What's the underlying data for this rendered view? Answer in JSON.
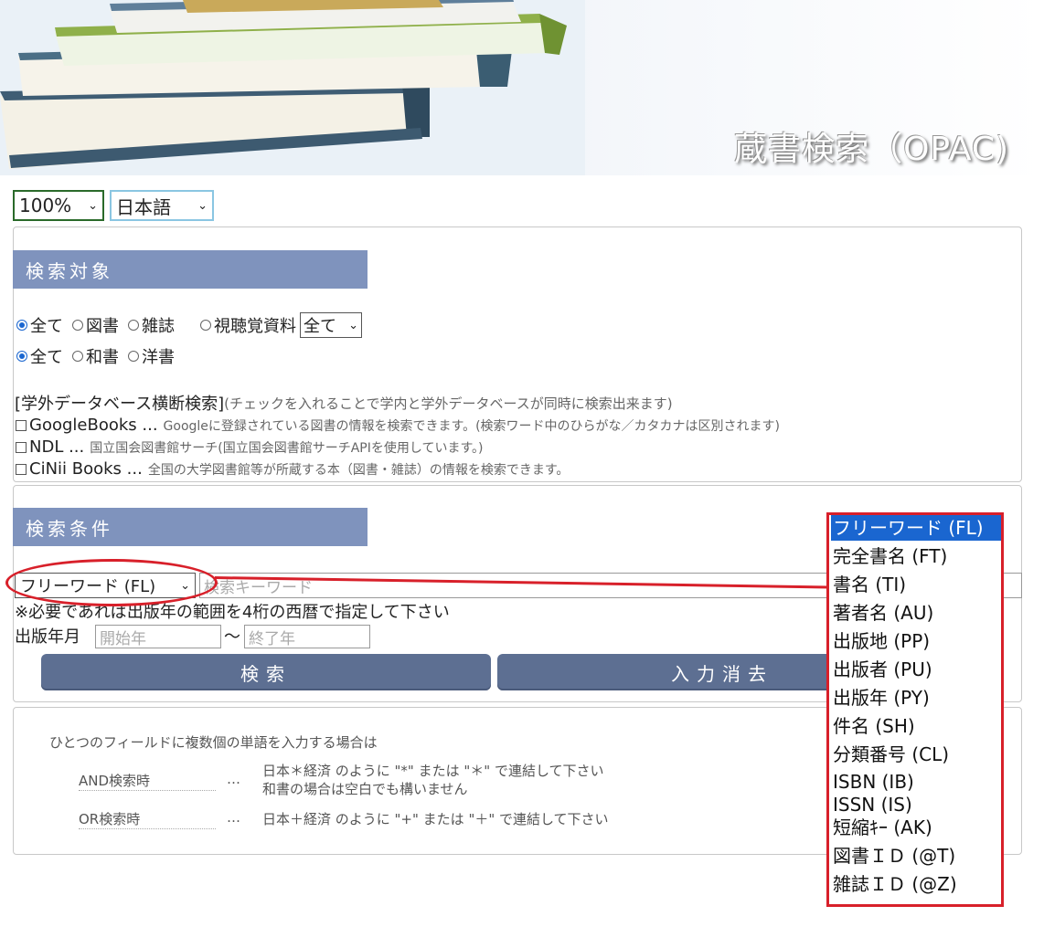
{
  "banner": {
    "title": "蔵書検索（OPAC)"
  },
  "toolbar": {
    "zoom": "100%",
    "language": "日本語"
  },
  "target": {
    "heading": "検索対象",
    "type_options": [
      "全て",
      "図書",
      "雑誌"
    ],
    "av_label": "視聴覚資料",
    "av_select": "全て",
    "lang_options": [
      "全て",
      "和書",
      "洋書"
    ],
    "cross_search_label": "[学外データベース横断検索]",
    "cross_search_note": "(チェックを入れることで学内と学外データベースが同時に検索出来ます)",
    "databases": [
      {
        "name": "GoogleBooks ...",
        "note": "Googleに登録されている図書の情報を検索できます。(検索ワード中のひらがな／カタカナは区別されます)"
      },
      {
        "name": "NDL ...",
        "note": "国立国会図書館サーチ(国立国会図書館サーチAPIを使用しています。)"
      },
      {
        "name": "CiNii Books ...",
        "note": "全国の大学図書館等が所蔵する本（図書・雑誌）の情報を検索できます。"
      }
    ]
  },
  "conditions": {
    "heading": "検索条件",
    "field_select": "フリーワード (FL)",
    "keyword_placeholder": "検索キーワード",
    "year_note": "※必要であれば出版年の範囲を4桁の西暦で指定して下さい",
    "year_label": "出版年月",
    "year_start_placeholder": "開始年",
    "year_sep": "〜",
    "year_end_placeholder": "終了年",
    "search_button": "検索",
    "clear_button": "入力消去"
  },
  "help": {
    "intro": "ひとつのフィールドに複数個の単語を入力する場合は",
    "and_label": "AND検索時",
    "and_dots": "…",
    "and_text1": "日本＊経済 のように \"*\" または \"＊\" で連結して下さい",
    "and_text2": "和書の場合は空白でも構いません",
    "or_label": "OR検索時",
    "or_dots": "…",
    "or_text": "日本＋経済 のように \"+\" または \"＋\" で連結して下さい"
  },
  "field_dropdown": {
    "options": [
      "フリーワード (FL)",
      "完全書名 (FT)",
      "書名 (TI)",
      "著者名 (AU)",
      "出版地 (PP)",
      "出版者 (PU)",
      "出版年 (PY)",
      "件名 (SH)",
      "分類番号 (CL)",
      "ISBN (IB)",
      "ISSN (IS)",
      "短縮ｷｰ (AK)",
      "図書ＩＤ (@T)",
      "雑誌ＩＤ (@Z)"
    ],
    "selected_index": 0
  },
  "colors": {
    "accent_blue": "#1a66d0",
    "header_bar": "#7f93bd",
    "button": "#5d6f92",
    "annotation_red": "#d8202a"
  }
}
